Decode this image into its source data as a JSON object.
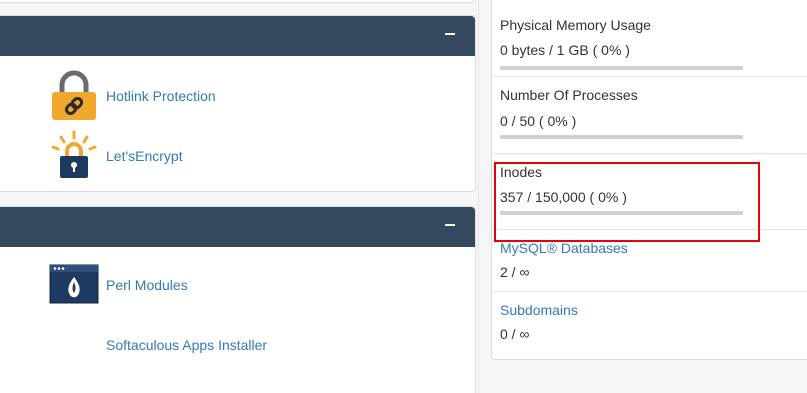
{
  "tools": {
    "panel1": {
      "items": [
        {
          "label": "Hotlink Protection",
          "icon": "padlock-link-icon"
        },
        {
          "label": "Let'sEncrypt",
          "icon": "letsencrypt-lock-icon"
        }
      ]
    },
    "panel2": {
      "items": [
        {
          "label": "Perl Modules",
          "icon": "perl-modules-icon"
        },
        {
          "label": "Softaculous Apps Installer",
          "icon": null
        }
      ]
    }
  },
  "stats": [
    {
      "title": "Physical Memory Usage",
      "value": "0 bytes / 1 GB ( 0% )",
      "percent": 0,
      "has_bar": true
    },
    {
      "title": "Number Of Processes",
      "value": "0 / 50 ( 0% )",
      "percent": 0,
      "has_bar": true
    },
    {
      "title": "Inodes",
      "value": "357 / 150,000 ( 0% )",
      "percent": 0,
      "has_bar": true,
      "highlighted": true
    },
    {
      "title": "MySQL® Databases",
      "value": "2 / ∞",
      "has_bar": false,
      "is_link": true
    },
    {
      "title": "Subdomains",
      "value": "0 / ∞",
      "has_bar": false,
      "is_link": true
    }
  ],
  "colors": {
    "panel_header": "#34495e",
    "link": "#337ab7",
    "highlight": "#e8000b",
    "icon_orange": "#f0a82f",
    "icon_navy": "#1f3a60"
  }
}
